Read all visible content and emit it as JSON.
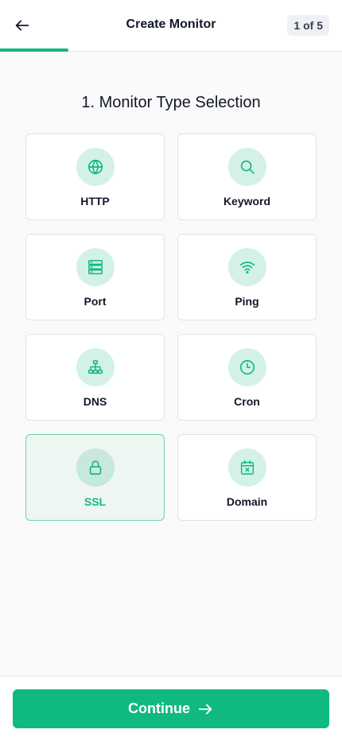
{
  "header": {
    "title": "Create Monitor",
    "step_badge": "1 of 5",
    "progress": 0.2
  },
  "section": {
    "title": "1. Monitor Type Selection"
  },
  "monitor_types": [
    {
      "label": "HTTP",
      "icon": "globe-icon",
      "selected": false
    },
    {
      "label": "Keyword",
      "icon": "search-icon",
      "selected": false
    },
    {
      "label": "Port",
      "icon": "server-icon",
      "selected": false
    },
    {
      "label": "Ping",
      "icon": "wifi-icon",
      "selected": false
    },
    {
      "label": "DNS",
      "icon": "network-icon",
      "selected": false
    },
    {
      "label": "Cron",
      "icon": "clock-icon",
      "selected": false
    },
    {
      "label": "SSL",
      "icon": "lock-icon",
      "selected": true
    },
    {
      "label": "Domain",
      "icon": "calendar-x-icon",
      "selected": false
    }
  ],
  "footer": {
    "continue_label": "Continue"
  },
  "colors": {
    "accent": "#10b981",
    "icon_bg": "#d3f2e5",
    "selected_bg": "#eef6f2"
  }
}
